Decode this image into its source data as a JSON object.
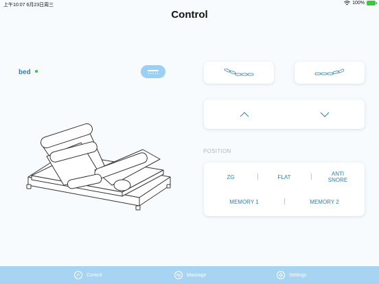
{
  "status_bar": {
    "time_date": "上午10:07  6月23日周三",
    "battery": "100%"
  },
  "title": "Control",
  "bed": {
    "name": "bed",
    "online_color": "#33c24d"
  },
  "icons": {
    "light": "light-icon",
    "preset_sit": "bed-sit-position-icon",
    "preset_lift": "bed-leg-lift-position-icon",
    "up": "chevron-up-icon",
    "down": "chevron-down-icon"
  },
  "position": {
    "section_label": "POSITION",
    "buttons": [
      "ZG",
      "FLAT",
      "ANTI\nSNORE",
      "MEMORY 1",
      "MEMORY 2"
    ]
  },
  "tabs": [
    {
      "label": "Control",
      "icon": "control-icon"
    },
    {
      "label": "Massage",
      "icon": "massage-icon"
    },
    {
      "label": "Settings",
      "icon": "settings-icon"
    }
  ],
  "colors": {
    "accent": "#2f7fae",
    "tab_bar": "#a7d4f3",
    "light_button": "#9bd0f2"
  }
}
